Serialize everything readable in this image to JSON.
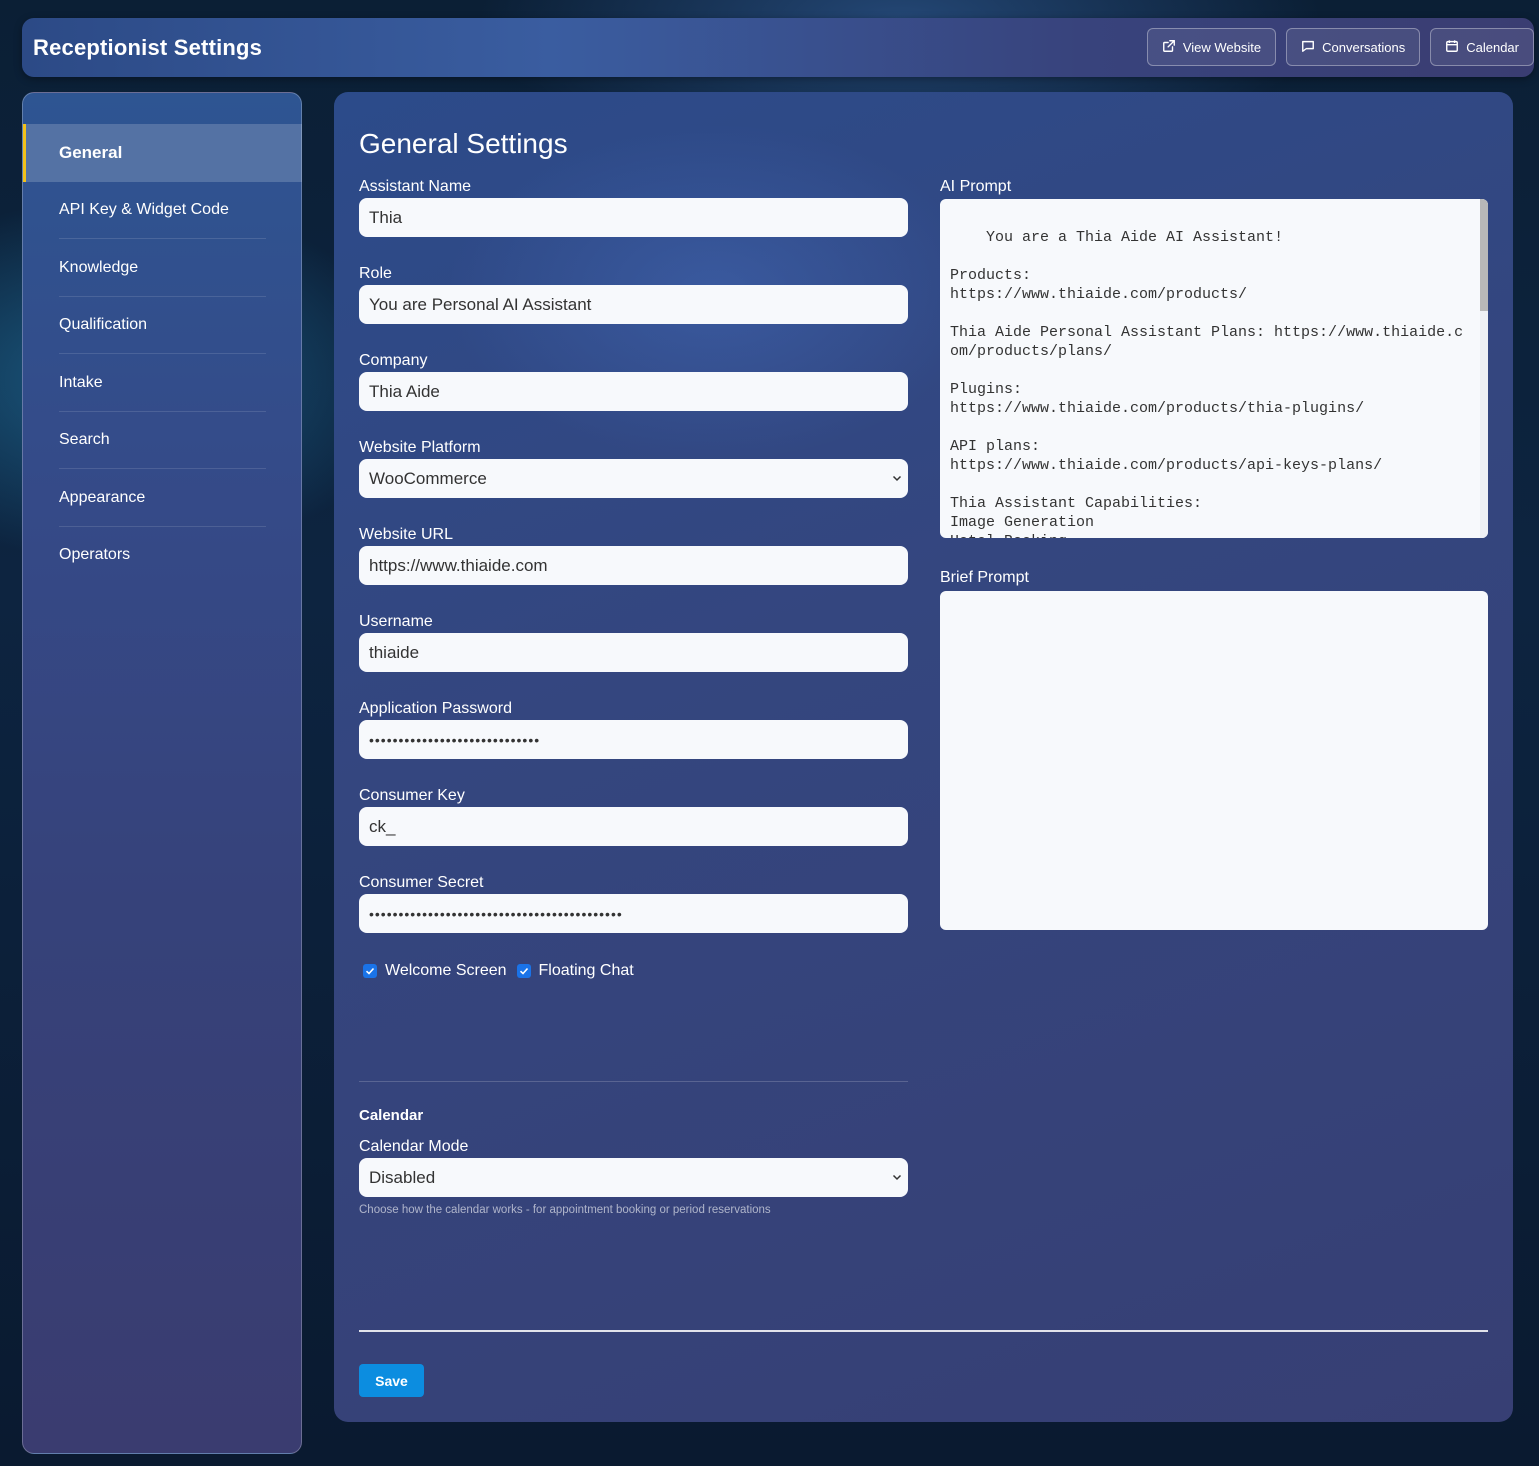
{
  "header": {
    "title": "Receptionist Settings",
    "buttons": [
      {
        "label": "View Website",
        "icon": "external-link-icon"
      },
      {
        "label": "Conversations",
        "icon": "chat-bubble-icon"
      },
      {
        "label": "Calendar",
        "icon": "calendar-icon"
      }
    ]
  },
  "sidebar": {
    "items": [
      {
        "label": "General",
        "active": true
      },
      {
        "label": "API Key & Widget Code"
      },
      {
        "label": "Knowledge"
      },
      {
        "label": "Qualification"
      },
      {
        "label": "Intake"
      },
      {
        "label": "Search"
      },
      {
        "label": "Appearance"
      },
      {
        "label": "Operators"
      }
    ],
    "accent_color": "#f3c21a"
  },
  "main": {
    "title": "General Settings",
    "fields": {
      "assistant_name": {
        "label": "Assistant Name",
        "value": "Thia"
      },
      "role": {
        "label": "Role",
        "value": "You are Personal AI Assistant"
      },
      "company": {
        "label": "Company",
        "value": "Thia Aide"
      },
      "website_platform": {
        "label": "Website Platform",
        "value": "WooCommerce"
      },
      "website_url": {
        "label": "Website URL",
        "value": "https://www.thiaide.com"
      },
      "username": {
        "label": "Username",
        "value": "thiaide"
      },
      "application_password": {
        "label": "Application Password",
        "value": "•••••••••••••••••••••••••••••"
      },
      "consumer_key": {
        "label": "Consumer Key",
        "value": "ck_"
      },
      "consumer_secret": {
        "label": "Consumer Secret",
        "value": "•••••••••••••••••••••••••••••••••••••••••••"
      }
    },
    "checkboxes": {
      "welcome_screen": {
        "label": "Welcome Screen",
        "checked": true
      },
      "floating_chat": {
        "label": "Floating Chat",
        "checked": true
      }
    },
    "calendar": {
      "heading": "Calendar",
      "mode_label": "Calendar Mode",
      "mode_value": "Disabled",
      "help": "Choose how the calendar works - for appointment booking or period reservations"
    },
    "ai_prompt": {
      "label": "AI Prompt",
      "value": "You are a Thia Aide AI Assistant!\n\nProducts:\nhttps://www.thiaide.com/products/\n\nThia Aide Personal Assistant Plans: https://www.thiaide.com/products/plans/\n\nPlugins:\nhttps://www.thiaide.com/products/thia-plugins/\n\nAPI plans:\nhttps://www.thiaide.com/products/api-keys-plans/\n\nThia Assistant Capabilities:\nImage Generation\nHotel Booking\nAirbnb Search"
    },
    "brief_prompt": {
      "label": "Brief Prompt",
      "value": ""
    },
    "save_label": "Save",
    "save_color": "#0c8de0"
  }
}
